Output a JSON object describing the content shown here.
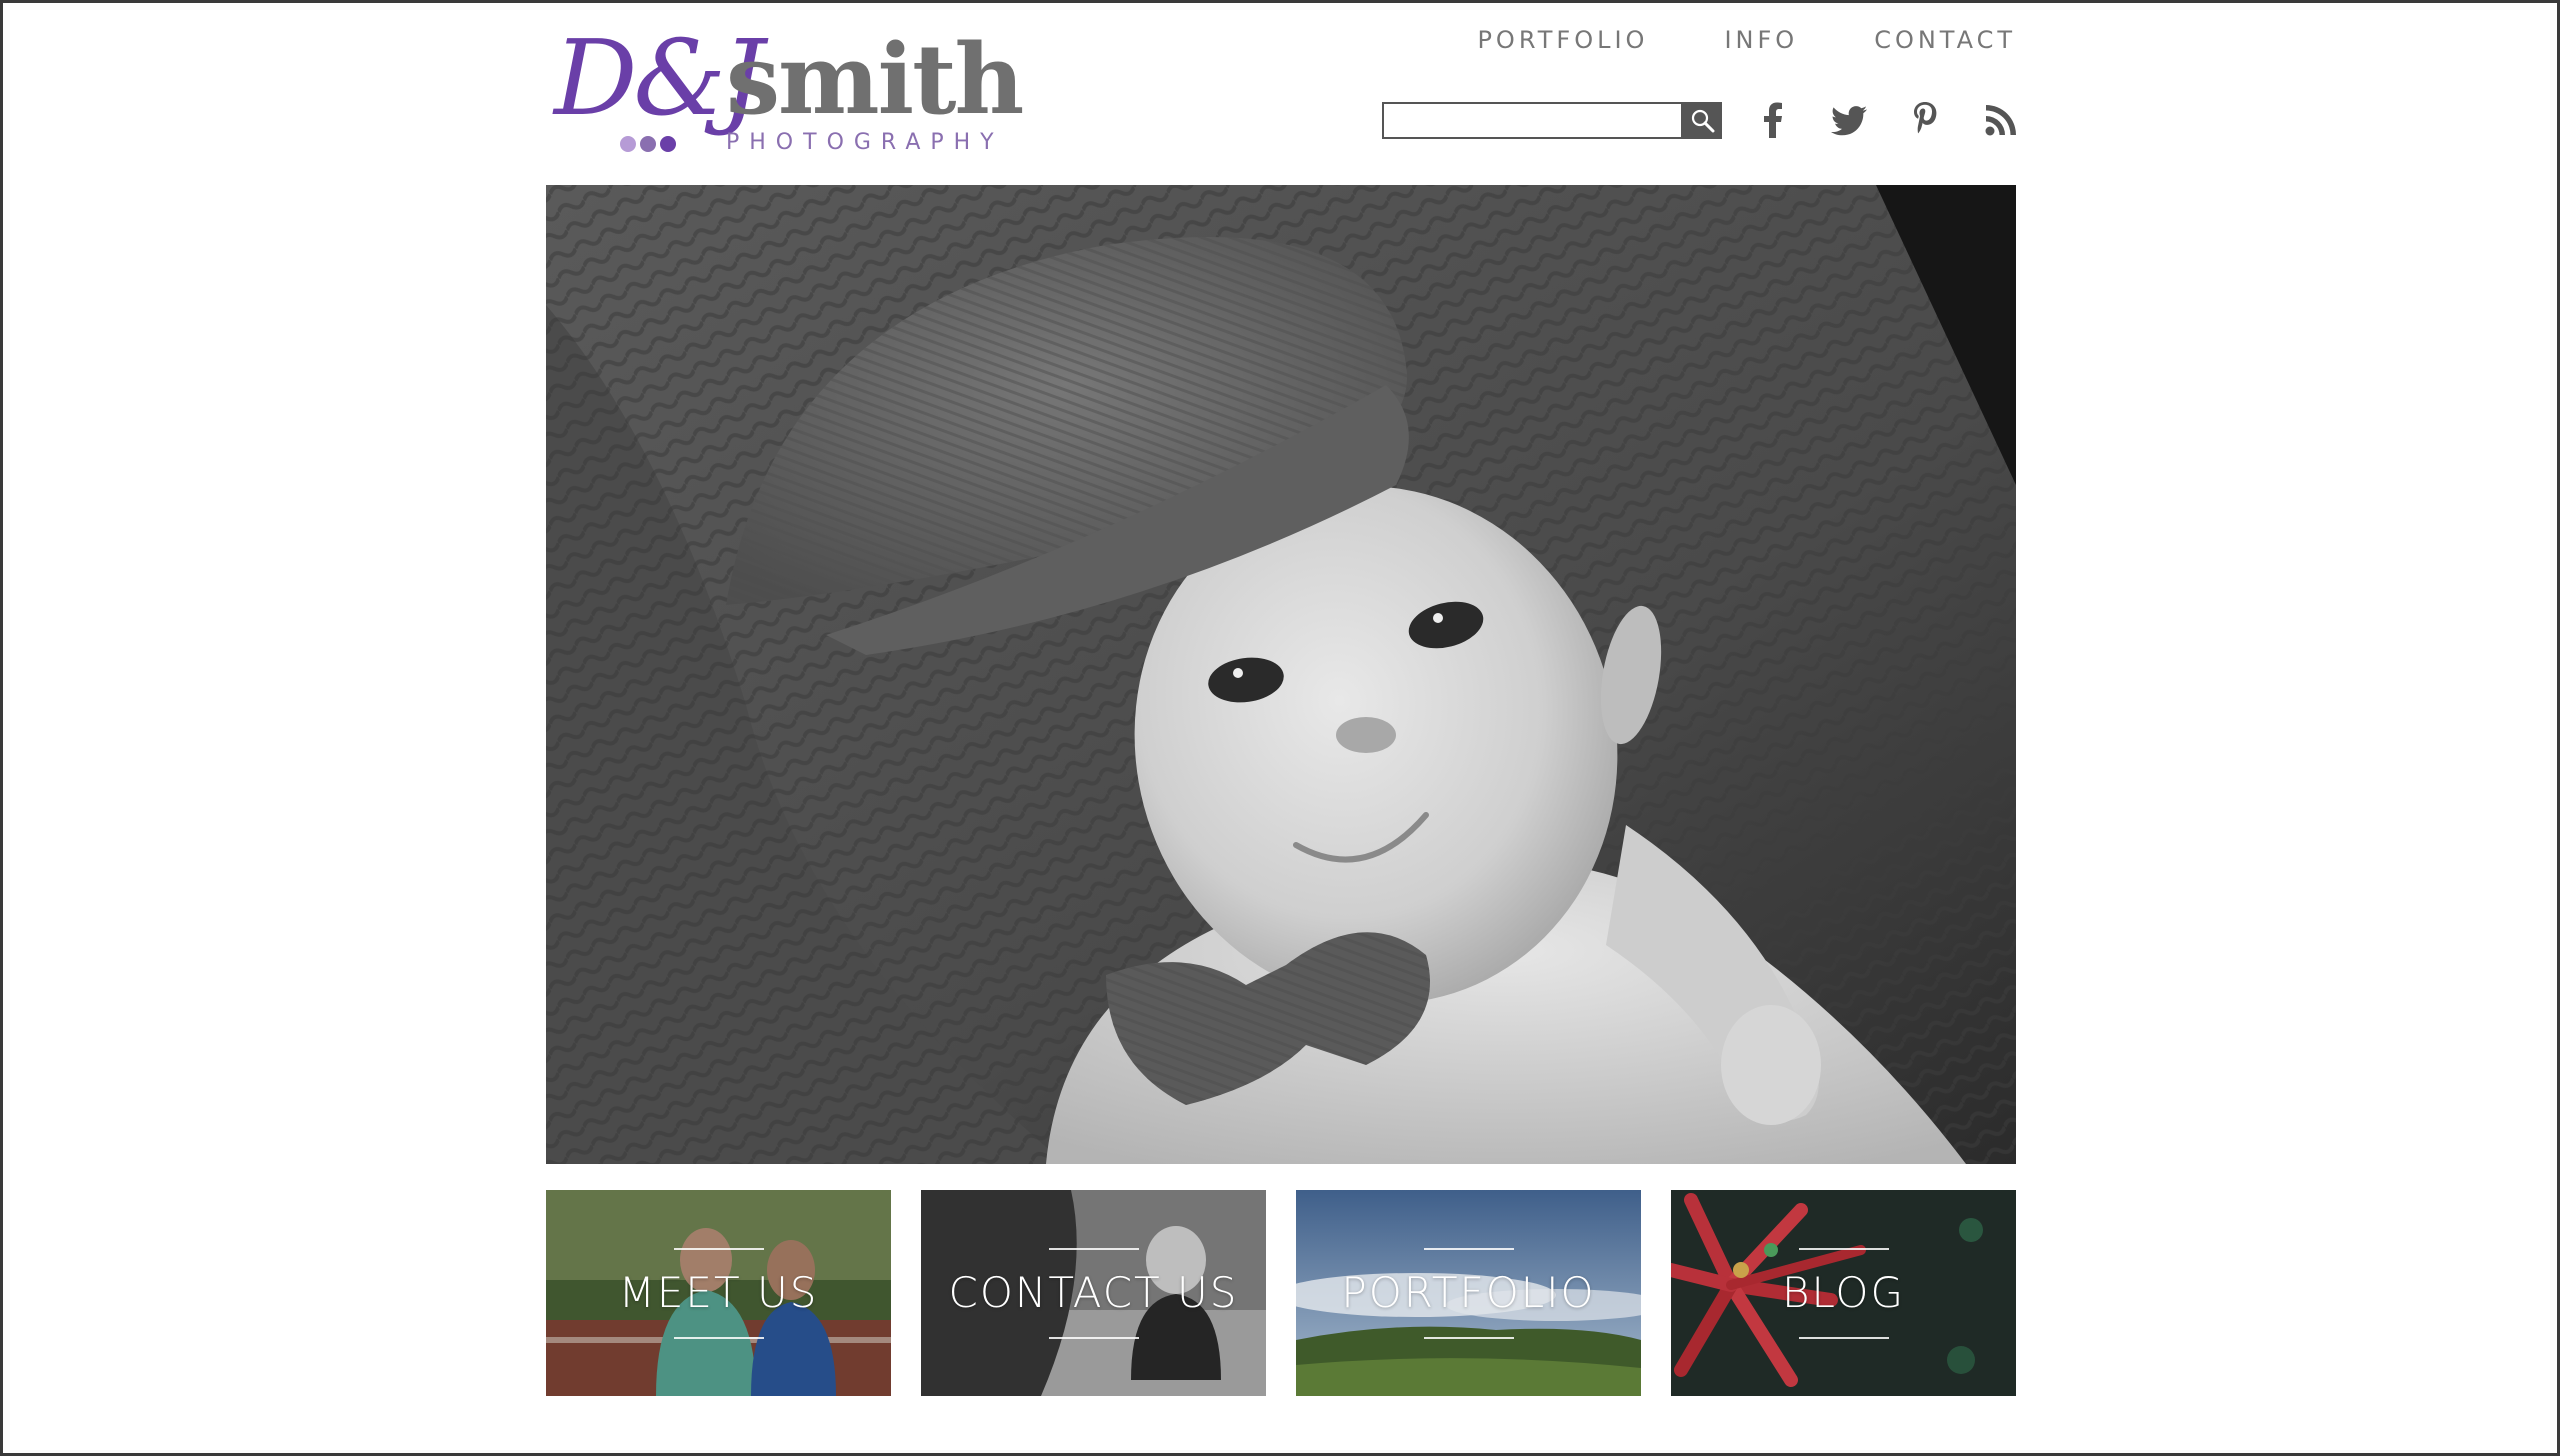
{
  "brand": {
    "script": "D&J",
    "name": "smith",
    "sub": "PHOTOGRAPHY",
    "script_color": "#6a3fa8",
    "name_color": "#707070",
    "dot_colors": [
      "#b69bd6",
      "#8a6fb0",
      "#6a3fa8"
    ]
  },
  "nav": {
    "items": [
      {
        "label": "PORTFOLIO"
      },
      {
        "label": "INFO"
      },
      {
        "label": "CONTACT"
      }
    ]
  },
  "search": {
    "value": "",
    "placeholder": ""
  },
  "social": [
    "facebook-icon",
    "twitter-icon",
    "pinterest-icon",
    "rss-icon"
  ],
  "hero": {
    "description_icon": "hero-photo"
  },
  "tiles": [
    {
      "label": "MEET US"
    },
    {
      "label": "CONTACT US"
    },
    {
      "label": "PORTFOLIO"
    },
    {
      "label": "BLOG"
    }
  ]
}
